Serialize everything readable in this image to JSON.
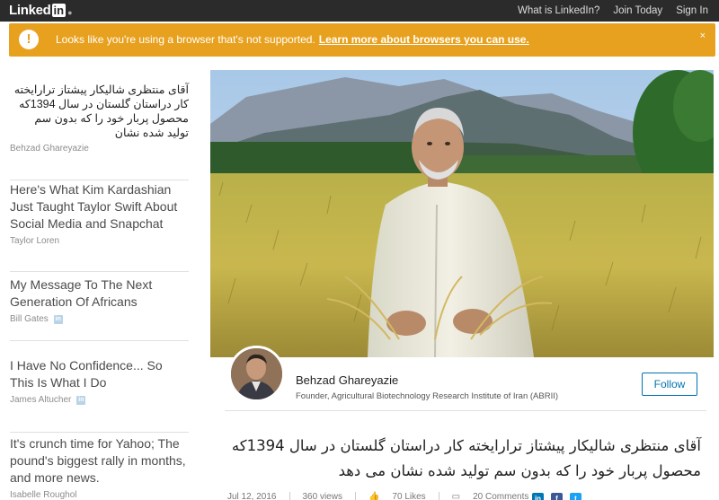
{
  "header": {
    "logo_text": "Linked",
    "logo_in": "in",
    "nav": [
      "What is LinkedIn?",
      "Join Today",
      "Sign In"
    ]
  },
  "banner": {
    "icon": "!",
    "message": "Looks like you're using a browser that's not supported.",
    "link": "Learn more about browsers you can use.",
    "close": "×"
  },
  "feed": [
    {
      "title": "آقای منتظری شالیکار پیشتاز ترارایخته کار دراستان گلستان در سال 1394که محصول پربار خود را که بدون سم تولید شده نشان",
      "author": "Behzad Ghareyazie",
      "verified": false
    },
    {
      "title": "Here's What Kim Kardashian Just Taught Taylor Swift About Social Media and Snapchat",
      "author": "Taylor Loren",
      "verified": false
    },
    {
      "title": "My Message To The Next Generation Of Africans",
      "author": "Bill Gates",
      "verified": true
    },
    {
      "title": "I Have No Confidence... So This Is What I Do",
      "author": "James Altucher",
      "verified": true
    },
    {
      "title": "It's crunch time for Yahoo; The pound's biggest rally in months, and more news.",
      "author": "Isabelle Roughol",
      "verified": false
    }
  ],
  "article": {
    "author_name": "Behzad Ghareyazie",
    "author_headline": "Founder, Agricultural Biotechnology Research Institute of Iran (ABRII)",
    "follow_label": "Follow",
    "title": "آقای منتظری شالیکار پیشتاز ترارایخته کار دراستان گلستان در سال 1394که محصول پربار خود را که بدون سم تولید شده نشان می دهد",
    "date": "Jul 12, 2016",
    "views": "360 views",
    "likes": "70 Likes",
    "comments": "20 Comments"
  },
  "colors": {
    "topbar": "#2b2b2b",
    "banner": "#e8a11f",
    "link_blue": "#0073b1"
  },
  "icons": {
    "banner": "exclamation-icon",
    "close": "close-icon",
    "likes": "thumbs-up-icon",
    "comments": "comment-icon",
    "share": [
      "linkedin-share-icon",
      "facebook-share-icon",
      "twitter-share-icon"
    ]
  }
}
